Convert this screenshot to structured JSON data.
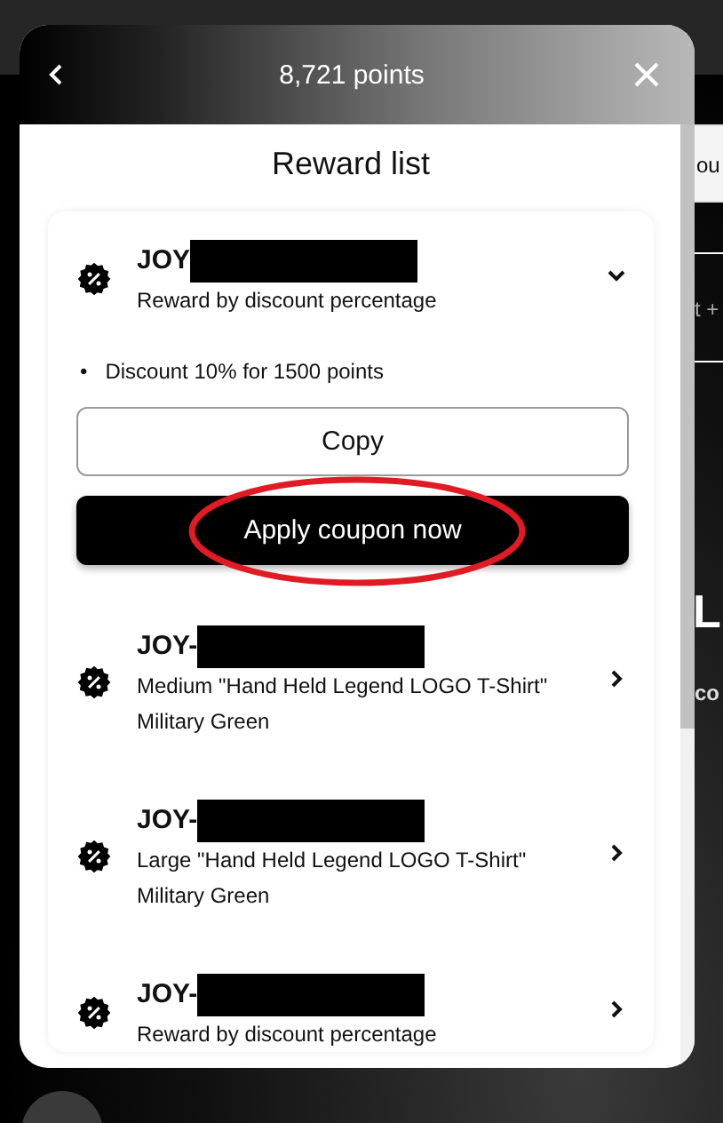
{
  "header": {
    "title": "8,721 points"
  },
  "content": {
    "title": "Reward list"
  },
  "rewards": [
    {
      "code": "JOY",
      "redacted": true,
      "lines": [
        "Reward by discount percentage"
      ],
      "expanded": true,
      "details": [
        {
          "marker": "•",
          "text": "Discount 10% for 1500 points"
        }
      ],
      "actions": [
        {
          "label": "Copy",
          "kind": "outline",
          "circled": false
        },
        {
          "label": "Apply coupon now",
          "kind": "primary",
          "circled": true
        }
      ]
    },
    {
      "code": "JOY-",
      "redacted": true,
      "lines": [
        "Medium \"Hand Held Legend LOGO T-Shirt\"",
        "Military Green"
      ],
      "expanded": false
    },
    {
      "code": "JOY-",
      "redacted": true,
      "lines": [
        "Large \"Hand Held Legend LOGO T-Shirt\"",
        "Military Green"
      ],
      "expanded": false
    },
    {
      "code": "JOY-",
      "redacted": true,
      "lines": [
        "Reward by discount percentage"
      ],
      "expanded": false
    }
  ],
  "background": {
    "fragments": [
      {
        "kind": "cell",
        "text": "ou"
      },
      {
        "kind": "plain",
        "text": "t +"
      },
      {
        "kind": "large",
        "text": "L"
      },
      {
        "kind": "bold",
        "text": "co"
      }
    ]
  }
}
